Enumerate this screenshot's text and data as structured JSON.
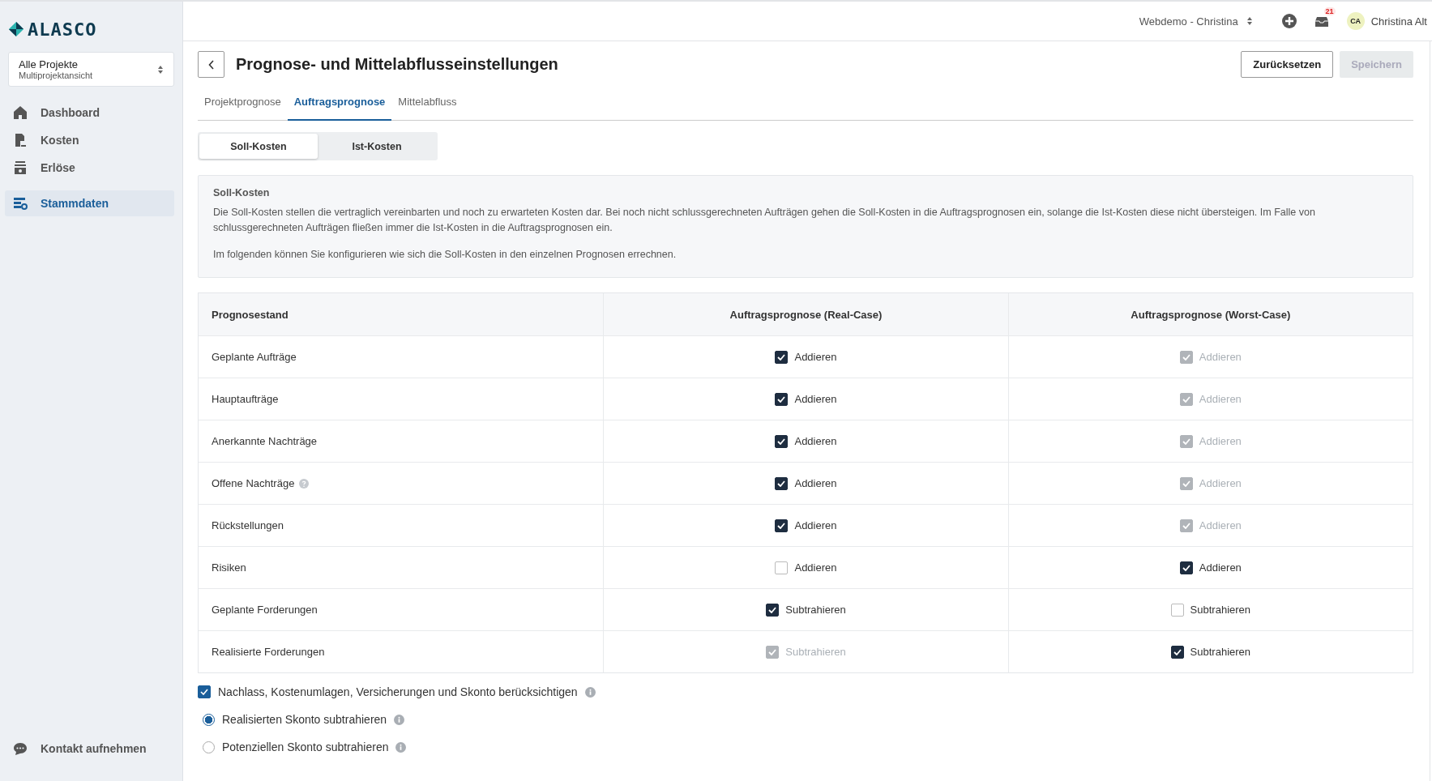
{
  "sidebar": {
    "logo": "ALASCO",
    "project_selector": {
      "title": "Alle Projekte",
      "subtitle": "Multiprojektansicht"
    },
    "items": [
      {
        "label": "Dashboard",
        "selected": false
      },
      {
        "label": "Kosten",
        "selected": false
      },
      {
        "label": "Erlöse",
        "selected": false
      },
      {
        "label": "Stammdaten",
        "selected": true
      }
    ],
    "footer_link": "Kontakt aufnehmen"
  },
  "topbar": {
    "workspace": "Webdemo - Christina",
    "notification_count": "21",
    "avatar_initials": "CA",
    "user_name": "Christina Alt"
  },
  "page": {
    "title": "Prognose- und Mittelabflusseinstellungen",
    "reset_button": "Zurücksetzen",
    "save_button": {
      "label": "Speichern",
      "disabled": true
    }
  },
  "tabs": [
    {
      "label": "Projektprognose",
      "selected": false
    },
    {
      "label": "Auftragsprognose",
      "selected": true
    },
    {
      "label": "Mittelabfluss",
      "selected": false
    }
  ],
  "segments": [
    {
      "label": "Soll-Kosten",
      "selected": true
    },
    {
      "label": "Ist-Kosten",
      "selected": false
    }
  ],
  "info": {
    "title": "Soll-Kosten",
    "paragraphs": [
      "Die Soll-Kosten stellen die vertraglich vereinbarten und noch zu erwarteten Kosten dar. Bei noch nicht schlussgerechneten Aufträgen gehen die Soll-Kosten in die Auftragsprognosen ein, solange die Ist-Kosten diese nicht übersteigen. Im Falle von schlussgerechneten Aufträgen fließen immer die Ist-Kosten in die Auftragsprognosen ein.",
      "Im folgenden können Sie konfigurieren wie sich die Soll-Kosten in den einzelnen Prognosen errechnen."
    ]
  },
  "table": {
    "columns": [
      "Prognosestand",
      "Auftragsprognose (Real-Case)",
      "Auftragsprognose (Worst-Case)"
    ],
    "rows": [
      {
        "cells": [
          {
            "kind": "label",
            "label": "Geplante Aufträge",
            "help": false
          },
          {
            "kind": "checkbox",
            "label": "Addieren",
            "checked": true,
            "disabled": false
          },
          {
            "kind": "checkbox",
            "label": "Addieren",
            "checked": true,
            "disabled": true
          }
        ]
      },
      {
        "cells": [
          {
            "kind": "label",
            "label": "Hauptaufträge",
            "help": false
          },
          {
            "kind": "checkbox",
            "label": "Addieren",
            "checked": true,
            "disabled": false
          },
          {
            "kind": "checkbox",
            "label": "Addieren",
            "checked": true,
            "disabled": true
          }
        ]
      },
      {
        "cells": [
          {
            "kind": "label",
            "label": "Anerkannte Nachträge",
            "help": false
          },
          {
            "kind": "checkbox",
            "label": "Addieren",
            "checked": true,
            "disabled": false
          },
          {
            "kind": "checkbox",
            "label": "Addieren",
            "checked": true,
            "disabled": true
          }
        ]
      },
      {
        "cells": [
          {
            "kind": "label",
            "label": "Offene Nachträge",
            "help": true
          },
          {
            "kind": "checkbox",
            "label": "Addieren",
            "checked": true,
            "disabled": false
          },
          {
            "kind": "checkbox",
            "label": "Addieren",
            "checked": true,
            "disabled": true
          }
        ]
      },
      {
        "cells": [
          {
            "kind": "label",
            "label": "Rückstellungen",
            "help": false
          },
          {
            "kind": "checkbox",
            "label": "Addieren",
            "checked": true,
            "disabled": false
          },
          {
            "kind": "checkbox",
            "label": "Addieren",
            "checked": true,
            "disabled": true
          }
        ]
      },
      {
        "cells": [
          {
            "kind": "label",
            "label": "Risiken",
            "help": false
          },
          {
            "kind": "checkbox",
            "label": "Addieren",
            "checked": false,
            "disabled": false
          },
          {
            "kind": "checkbox",
            "label": "Addieren",
            "checked": true,
            "disabled": false
          }
        ]
      },
      {
        "cells": [
          {
            "kind": "label",
            "label": "Geplante Forderungen",
            "help": false
          },
          {
            "kind": "checkbox",
            "label": "Subtrahieren",
            "checked": true,
            "disabled": false
          },
          {
            "kind": "checkbox",
            "label": "Subtrahieren",
            "checked": false,
            "disabled": false
          }
        ]
      },
      {
        "cells": [
          {
            "kind": "label",
            "label": "Realisierte Forderungen",
            "help": false
          },
          {
            "kind": "checkbox",
            "label": "Subtrahieren",
            "checked": true,
            "disabled": true
          },
          {
            "kind": "checkbox",
            "label": "Subtrahieren",
            "checked": true,
            "disabled": false
          }
        ]
      }
    ]
  },
  "options": {
    "main": {
      "label": "Nachlass, Kostenumlagen, Versicherungen und Skonto berücksichtigen",
      "checked": true
    },
    "radios": [
      {
        "label": "Realisierten Skonto subtrahieren",
        "selected": true
      },
      {
        "label": "Potenziellen Skonto subtrahieren",
        "selected": false
      }
    ]
  }
}
